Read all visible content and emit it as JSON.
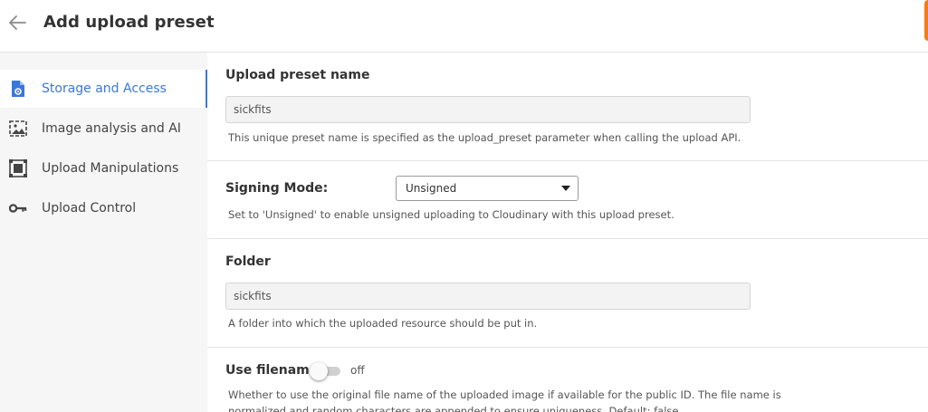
{
  "header": {
    "title": "Add upload preset",
    "back_icon": "arrow-left-icon",
    "accent_color": "#f07c1f"
  },
  "sidebar": {
    "active_color": "#3b78d8",
    "items": [
      {
        "label": "Storage and Access",
        "icon": "document-gear-icon",
        "active": true
      },
      {
        "label": "Image analysis and AI",
        "icon": "image-frame-icon",
        "active": false
      },
      {
        "label": "Upload Manipulations",
        "icon": "crop-frame-icon",
        "active": false
      },
      {
        "label": "Upload Control",
        "icon": "key-icon",
        "active": false
      }
    ]
  },
  "form": {
    "preset_name": {
      "label": "Upload preset name",
      "value": "sickfits",
      "help": "This unique preset name is specified as the upload_preset parameter when calling the upload API."
    },
    "signing_mode": {
      "label": "Signing Mode:",
      "value": "Unsigned",
      "help": "Set to 'Unsigned' to enable unsigned uploading to Cloudinary with this upload preset."
    },
    "folder": {
      "label": "Folder",
      "value": "sickfits",
      "help": "A folder into which the uploaded resource should be put in."
    },
    "use_filename": {
      "label": "Use filename:",
      "state": "off",
      "enabled": false,
      "help_line1": "Whether to use the original file name of the uploaded image if available for the public ID. The file name is",
      "help_line2": "normalized and random characters are appended to ensure uniqueness. Default: false."
    }
  }
}
